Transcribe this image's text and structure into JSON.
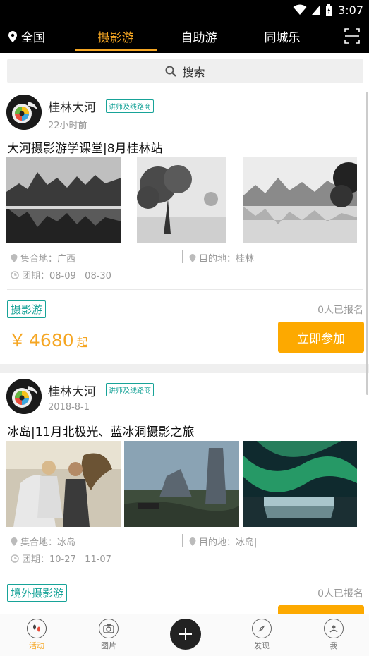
{
  "status_bar": {
    "time": "3:07"
  },
  "top_nav": {
    "location": "全国",
    "tabs": [
      {
        "label": "摄影游",
        "active": true
      },
      {
        "label": "自助游",
        "active": false
      },
      {
        "label": "同城乐",
        "active": false
      }
    ]
  },
  "search": {
    "label": "搜索"
  },
  "posts": [
    {
      "author": "桂林大河",
      "badge": "讲师及线路商",
      "time": "22小时前",
      "title": "大河摄影游学课堂|8月桂林站",
      "gather": "集合地：广西",
      "destination": "目的地：桂林",
      "period": "团期：08-09   08-30",
      "tag": "摄影游",
      "signed": "0人已报名",
      "price_symbol": "￥",
      "price": "4680",
      "price_suffix": "起",
      "join_label": "立即参加"
    },
    {
      "author": "桂林大河",
      "badge": "讲师及线路商",
      "time": "2018-8-1",
      "title": "冰岛|11月北极光、蓝冰洞摄影之旅",
      "gather": "集合地：冰岛",
      "destination": "目的地：冰岛|",
      "period": "团期：10-27   11-07",
      "tag": "境外摄影游",
      "signed": "0人已报名"
    }
  ],
  "tab_bar": {
    "items": [
      {
        "label": "活动",
        "icon": "footprint-icon",
        "active": true
      },
      {
        "label": "图片",
        "icon": "camera-icon",
        "active": false
      },
      {
        "label": "发现",
        "icon": "compass-icon",
        "active": false
      },
      {
        "label": "我",
        "icon": "profile-icon",
        "active": false
      }
    ]
  },
  "colors": {
    "accent": "#f5a623",
    "button": "#fda900",
    "teal": "#17a398"
  }
}
